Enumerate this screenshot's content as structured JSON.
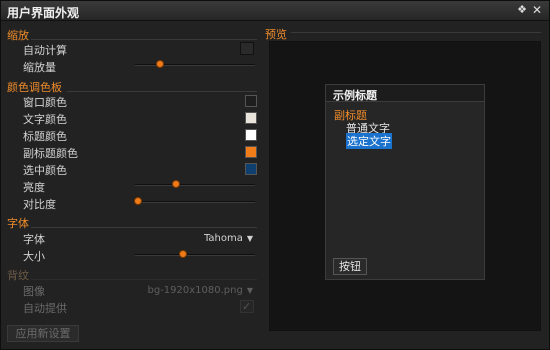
{
  "window": {
    "title": "用户界面外观"
  },
  "scale": {
    "section": "缩放",
    "auto_compute": "自动计算",
    "scale_amount": "缩放量",
    "scale_value": 0.2
  },
  "palette": {
    "section": "颜色调色板",
    "items": [
      {
        "label": "窗口颜色",
        "color": "#1e1e1e"
      },
      {
        "label": "文字颜色",
        "color": "#e8e4dc"
      },
      {
        "label": "标题颜色",
        "color": "#ffffff"
      },
      {
        "label": "副标题颜色",
        "color": "#f07d19"
      },
      {
        "label": "选中颜色",
        "color": "#0f3f6e"
      }
    ],
    "brightness": "亮度",
    "brightness_value": 0.34,
    "contrast": "对比度",
    "contrast_value": 0.0
  },
  "font": {
    "section": "字体",
    "font_label": "字体",
    "font_value": "Tahoma",
    "size_label": "大小",
    "size_value": 0.4
  },
  "texture": {
    "section": "背纹",
    "image_label": "图像",
    "image_value": "bg-1920x1080.png",
    "auto_label": "自动提供",
    "auto_checked": true
  },
  "apply_button": "应用新设置",
  "preview": {
    "label": "预览",
    "sample_title": "示例标题",
    "sample_subtitle": "副标题",
    "sample_normal": "普通文字",
    "sample_selected": "选定文字",
    "sample_button": "按钮"
  },
  "colors": {
    "accent": "#f08c2b",
    "selection": "#1a72cc"
  },
  "icons": {
    "pin": "pin-icon",
    "close": "close-icon",
    "dropdown": "chevron-down-icon",
    "check": "check-icon"
  }
}
